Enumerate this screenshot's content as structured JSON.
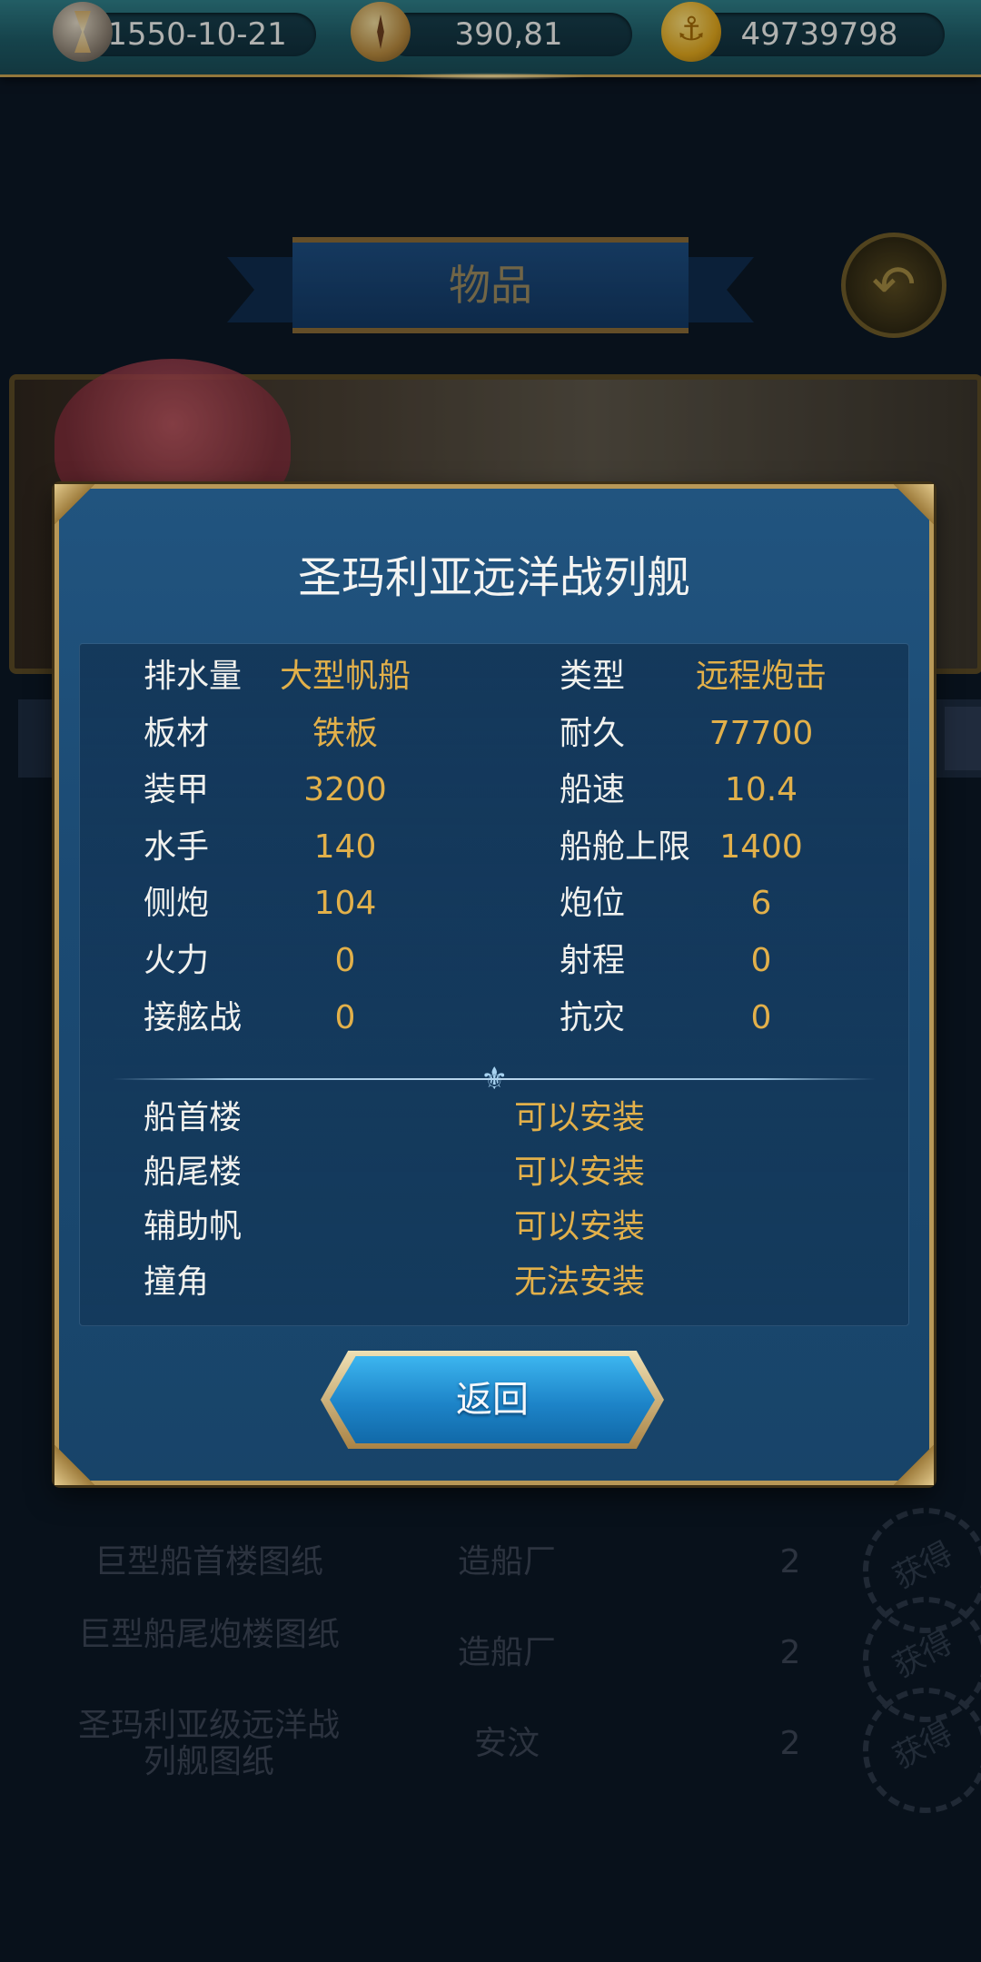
{
  "topbar": {
    "date": "1550-10-21",
    "coordinates": "390,81",
    "gold": "49739798"
  },
  "page": {
    "title": "物品",
    "background_rows": [
      {
        "name": "巨型船首楼图纸",
        "place": "造船厂",
        "count": "2"
      },
      {
        "name": "巨型船尾炮楼图纸",
        "place": "造船厂",
        "count": "2"
      },
      {
        "name": "圣玛利亚级远洋战列舰图纸",
        "place": "安汶",
        "count": "2"
      }
    ],
    "stamp_label": "获得"
  },
  "dialog": {
    "title": "圣玛利亚远洋战列舰",
    "stats": [
      {
        "label": "排水量",
        "value": "大型帆船"
      },
      {
        "label": "类型",
        "value": "远程炮击"
      },
      {
        "label": "板材",
        "value": "铁板"
      },
      {
        "label": "耐久",
        "value": "77700"
      },
      {
        "label": "装甲",
        "value": "3200"
      },
      {
        "label": "船速",
        "value": "10.4"
      },
      {
        "label": "水手",
        "value": "140"
      },
      {
        "label": "船舱上限",
        "value": "1400"
      },
      {
        "label": "侧炮",
        "value": "104"
      },
      {
        "label": "炮位",
        "value": "6"
      },
      {
        "label": "火力",
        "value": "0"
      },
      {
        "label": "射程",
        "value": "0"
      },
      {
        "label": "接舷战",
        "value": "0"
      },
      {
        "label": "抗灾",
        "value": "0"
      }
    ],
    "slots": [
      {
        "label": "船首楼",
        "value": "可以安装"
      },
      {
        "label": "船尾楼",
        "value": "可以安装"
      },
      {
        "label": "辅助帆",
        "value": "可以安装"
      },
      {
        "label": "撞角",
        "value": "无法安装"
      }
    ],
    "return_label": "返回"
  }
}
